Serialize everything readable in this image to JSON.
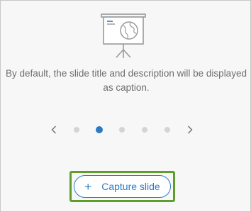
{
  "panel": {
    "illustration_icon": "presentation-easel-globe-icon",
    "caption": "By default, the slide title and description will be displayed as caption."
  },
  "pager": {
    "prev_icon": "chevron-left-icon",
    "next_icon": "chevron-right-icon",
    "dot_count": 5,
    "active_index": 1
  },
  "capture": {
    "plus_icon": "+",
    "label": "Capture slide",
    "highlight_color": "#5f9e2c"
  },
  "colors": {
    "accent": "#2b7bc4",
    "text_muted": "#6e6e6e",
    "dot_inactive": "#d4d4d4",
    "panel_bg": "#f7f7f7"
  }
}
